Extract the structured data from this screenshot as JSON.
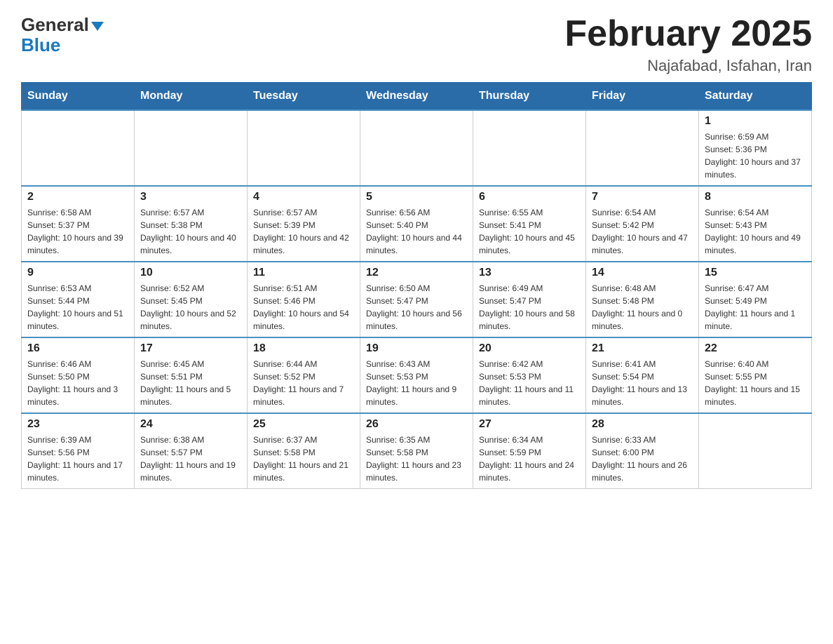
{
  "header": {
    "logo_general": "General",
    "logo_blue": "Blue",
    "month_title": "February 2025",
    "location": "Najafabad, Isfahan, Iran"
  },
  "weekdays": [
    "Sunday",
    "Monday",
    "Tuesday",
    "Wednesday",
    "Thursday",
    "Friday",
    "Saturday"
  ],
  "days": [
    {
      "date": "",
      "sunrise": "",
      "sunset": "",
      "daylight": "",
      "empty": true
    },
    {
      "date": "",
      "sunrise": "",
      "sunset": "",
      "daylight": "",
      "empty": true
    },
    {
      "date": "",
      "sunrise": "",
      "sunset": "",
      "daylight": "",
      "empty": true
    },
    {
      "date": "",
      "sunrise": "",
      "sunset": "",
      "daylight": "",
      "empty": true
    },
    {
      "date": "",
      "sunrise": "",
      "sunset": "",
      "daylight": "",
      "empty": true
    },
    {
      "date": "",
      "sunrise": "",
      "sunset": "",
      "daylight": "",
      "empty": true
    },
    {
      "date": "1",
      "sunrise": "Sunrise: 6:59 AM",
      "sunset": "Sunset: 5:36 PM",
      "daylight": "Daylight: 10 hours and 37 minutes.",
      "empty": false
    },
    {
      "date": "2",
      "sunrise": "Sunrise: 6:58 AM",
      "sunset": "Sunset: 5:37 PM",
      "daylight": "Daylight: 10 hours and 39 minutes.",
      "empty": false
    },
    {
      "date": "3",
      "sunrise": "Sunrise: 6:57 AM",
      "sunset": "Sunset: 5:38 PM",
      "daylight": "Daylight: 10 hours and 40 minutes.",
      "empty": false
    },
    {
      "date": "4",
      "sunrise": "Sunrise: 6:57 AM",
      "sunset": "Sunset: 5:39 PM",
      "daylight": "Daylight: 10 hours and 42 minutes.",
      "empty": false
    },
    {
      "date": "5",
      "sunrise": "Sunrise: 6:56 AM",
      "sunset": "Sunset: 5:40 PM",
      "daylight": "Daylight: 10 hours and 44 minutes.",
      "empty": false
    },
    {
      "date": "6",
      "sunrise": "Sunrise: 6:55 AM",
      "sunset": "Sunset: 5:41 PM",
      "daylight": "Daylight: 10 hours and 45 minutes.",
      "empty": false
    },
    {
      "date": "7",
      "sunrise": "Sunrise: 6:54 AM",
      "sunset": "Sunset: 5:42 PM",
      "daylight": "Daylight: 10 hours and 47 minutes.",
      "empty": false
    },
    {
      "date": "8",
      "sunrise": "Sunrise: 6:54 AM",
      "sunset": "Sunset: 5:43 PM",
      "daylight": "Daylight: 10 hours and 49 minutes.",
      "empty": false
    },
    {
      "date": "9",
      "sunrise": "Sunrise: 6:53 AM",
      "sunset": "Sunset: 5:44 PM",
      "daylight": "Daylight: 10 hours and 51 minutes.",
      "empty": false
    },
    {
      "date": "10",
      "sunrise": "Sunrise: 6:52 AM",
      "sunset": "Sunset: 5:45 PM",
      "daylight": "Daylight: 10 hours and 52 minutes.",
      "empty": false
    },
    {
      "date": "11",
      "sunrise": "Sunrise: 6:51 AM",
      "sunset": "Sunset: 5:46 PM",
      "daylight": "Daylight: 10 hours and 54 minutes.",
      "empty": false
    },
    {
      "date": "12",
      "sunrise": "Sunrise: 6:50 AM",
      "sunset": "Sunset: 5:47 PM",
      "daylight": "Daylight: 10 hours and 56 minutes.",
      "empty": false
    },
    {
      "date": "13",
      "sunrise": "Sunrise: 6:49 AM",
      "sunset": "Sunset: 5:47 PM",
      "daylight": "Daylight: 10 hours and 58 minutes.",
      "empty": false
    },
    {
      "date": "14",
      "sunrise": "Sunrise: 6:48 AM",
      "sunset": "Sunset: 5:48 PM",
      "daylight": "Daylight: 11 hours and 0 minutes.",
      "empty": false
    },
    {
      "date": "15",
      "sunrise": "Sunrise: 6:47 AM",
      "sunset": "Sunset: 5:49 PM",
      "daylight": "Daylight: 11 hours and 1 minute.",
      "empty": false
    },
    {
      "date": "16",
      "sunrise": "Sunrise: 6:46 AM",
      "sunset": "Sunset: 5:50 PM",
      "daylight": "Daylight: 11 hours and 3 minutes.",
      "empty": false
    },
    {
      "date": "17",
      "sunrise": "Sunrise: 6:45 AM",
      "sunset": "Sunset: 5:51 PM",
      "daylight": "Daylight: 11 hours and 5 minutes.",
      "empty": false
    },
    {
      "date": "18",
      "sunrise": "Sunrise: 6:44 AM",
      "sunset": "Sunset: 5:52 PM",
      "daylight": "Daylight: 11 hours and 7 minutes.",
      "empty": false
    },
    {
      "date": "19",
      "sunrise": "Sunrise: 6:43 AM",
      "sunset": "Sunset: 5:53 PM",
      "daylight": "Daylight: 11 hours and 9 minutes.",
      "empty": false
    },
    {
      "date": "20",
      "sunrise": "Sunrise: 6:42 AM",
      "sunset": "Sunset: 5:53 PM",
      "daylight": "Daylight: 11 hours and 11 minutes.",
      "empty": false
    },
    {
      "date": "21",
      "sunrise": "Sunrise: 6:41 AM",
      "sunset": "Sunset: 5:54 PM",
      "daylight": "Daylight: 11 hours and 13 minutes.",
      "empty": false
    },
    {
      "date": "22",
      "sunrise": "Sunrise: 6:40 AM",
      "sunset": "Sunset: 5:55 PM",
      "daylight": "Daylight: 11 hours and 15 minutes.",
      "empty": false
    },
    {
      "date": "23",
      "sunrise": "Sunrise: 6:39 AM",
      "sunset": "Sunset: 5:56 PM",
      "daylight": "Daylight: 11 hours and 17 minutes.",
      "empty": false
    },
    {
      "date": "24",
      "sunrise": "Sunrise: 6:38 AM",
      "sunset": "Sunset: 5:57 PM",
      "daylight": "Daylight: 11 hours and 19 minutes.",
      "empty": false
    },
    {
      "date": "25",
      "sunrise": "Sunrise: 6:37 AM",
      "sunset": "Sunset: 5:58 PM",
      "daylight": "Daylight: 11 hours and 21 minutes.",
      "empty": false
    },
    {
      "date": "26",
      "sunrise": "Sunrise: 6:35 AM",
      "sunset": "Sunset: 5:58 PM",
      "daylight": "Daylight: 11 hours and 23 minutes.",
      "empty": false
    },
    {
      "date": "27",
      "sunrise": "Sunrise: 6:34 AM",
      "sunset": "Sunset: 5:59 PM",
      "daylight": "Daylight: 11 hours and 24 minutes.",
      "empty": false
    },
    {
      "date": "28",
      "sunrise": "Sunrise: 6:33 AM",
      "sunset": "Sunset: 6:00 PM",
      "daylight": "Daylight: 11 hours and 26 minutes.",
      "empty": false
    },
    {
      "date": "",
      "sunrise": "",
      "sunset": "",
      "daylight": "",
      "empty": true
    }
  ]
}
